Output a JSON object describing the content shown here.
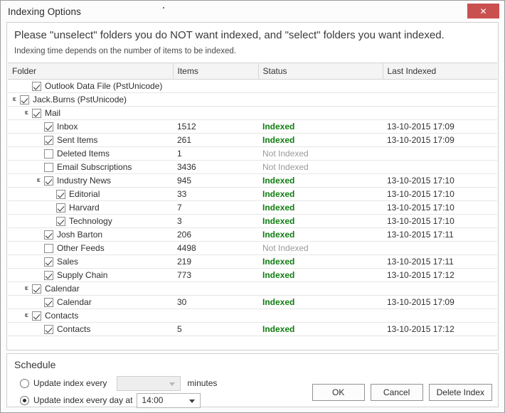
{
  "window": {
    "title": "Indexing Options",
    "close_label": "✕"
  },
  "instructions": {
    "main": "Please \"unselect\" folders you do NOT want indexed, and \"select\" folders you want indexed.",
    "sub": "Indexing time depends on the number of items to be indexed."
  },
  "table": {
    "columns": [
      "Folder",
      "Items",
      "Status",
      "Last Indexed"
    ],
    "rows": [
      {
        "indent": 1,
        "twisty": false,
        "checked": true,
        "folder": "Outlook Data File (PstUnicode)",
        "items": "",
        "status": "",
        "last": ""
      },
      {
        "indent": 0,
        "twisty": true,
        "checked": true,
        "folder": "Jack.Burns (PstUnicode)",
        "items": "",
        "status": "",
        "last": ""
      },
      {
        "indent": 1,
        "twisty": true,
        "checked": true,
        "folder": "Mail",
        "items": "",
        "status": "",
        "last": ""
      },
      {
        "indent": 2,
        "twisty": false,
        "checked": true,
        "folder": "Inbox",
        "items": "1512",
        "status": "Indexed",
        "last": "13-10-2015 17:09"
      },
      {
        "indent": 2,
        "twisty": false,
        "checked": true,
        "folder": "Sent Items",
        "items": "261",
        "status": "Indexed",
        "last": "13-10-2015 17:09"
      },
      {
        "indent": 2,
        "twisty": false,
        "checked": false,
        "folder": "Deleted Items",
        "items": "1",
        "status": "Not Indexed",
        "last": ""
      },
      {
        "indent": 2,
        "twisty": false,
        "checked": false,
        "folder": "Email Subscriptions",
        "items": "3436",
        "status": "Not Indexed",
        "last": ""
      },
      {
        "indent": 2,
        "twisty": true,
        "checked": true,
        "folder": "Industry News",
        "items": "945",
        "status": "Indexed",
        "last": "13-10-2015 17:10"
      },
      {
        "indent": 3,
        "twisty": false,
        "checked": true,
        "folder": "Editorial",
        "items": "33",
        "status": "Indexed",
        "last": "13-10-2015 17:10"
      },
      {
        "indent": 3,
        "twisty": false,
        "checked": true,
        "folder": "Harvard",
        "items": "7",
        "status": "Indexed",
        "last": "13-10-2015 17:10"
      },
      {
        "indent": 3,
        "twisty": false,
        "checked": true,
        "folder": "Technology",
        "items": "3",
        "status": "Indexed",
        "last": "13-10-2015 17:10"
      },
      {
        "indent": 2,
        "twisty": false,
        "checked": true,
        "folder": "Josh Barton",
        "items": "206",
        "status": "Indexed",
        "last": "13-10-2015 17:11"
      },
      {
        "indent": 2,
        "twisty": false,
        "checked": false,
        "folder": "Other Feeds",
        "items": "4498",
        "status": "Not Indexed",
        "last": ""
      },
      {
        "indent": 2,
        "twisty": false,
        "checked": true,
        "folder": "Sales",
        "items": "219",
        "status": "Indexed",
        "last": "13-10-2015 17:11"
      },
      {
        "indent": 2,
        "twisty": false,
        "checked": true,
        "folder": "Supply Chain",
        "items": "773",
        "status": "Indexed",
        "last": "13-10-2015 17:12"
      },
      {
        "indent": 1,
        "twisty": true,
        "checked": true,
        "folder": "Calendar",
        "items": "",
        "status": "",
        "last": ""
      },
      {
        "indent": 2,
        "twisty": false,
        "checked": true,
        "folder": "Calendar",
        "items": "30",
        "status": "Indexed",
        "last": "13-10-2015 17:09"
      },
      {
        "indent": 1,
        "twisty": true,
        "checked": true,
        "folder": "Contacts",
        "items": "",
        "status": "",
        "last": ""
      },
      {
        "indent": 2,
        "twisty": false,
        "checked": true,
        "folder": "Contacts",
        "items": "5",
        "status": "Indexed",
        "last": "13-10-2015 17:12"
      }
    ]
  },
  "schedule": {
    "title": "Schedule",
    "option_interval_label": "Update index every",
    "option_interval_selected": false,
    "interval_value": "",
    "units_label": "minutes",
    "option_daily_label": "Update index every day at",
    "option_daily_selected": true,
    "daily_value": "14:00"
  },
  "buttons": {
    "ok": "OK",
    "cancel": "Cancel",
    "delete_index": "Delete Index"
  },
  "colors": {
    "indexed": "#107c10",
    "not_indexed": "#9a9a9a",
    "close_button": "#c9504f"
  }
}
